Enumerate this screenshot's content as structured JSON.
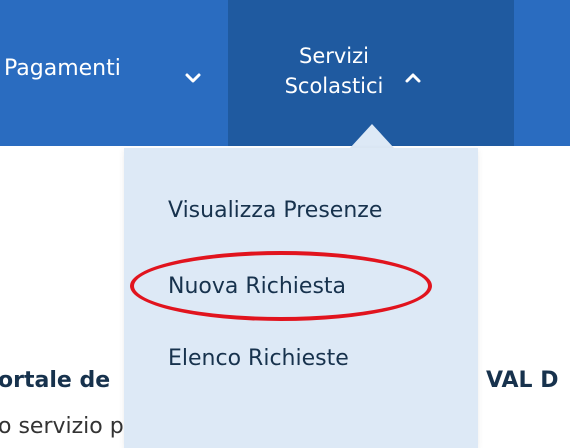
{
  "navbar": {
    "items": [
      {
        "label": "Pagamenti",
        "expanded": false,
        "icon": "chevron-down-icon"
      },
      {
        "label_line1": "Servizi",
        "label_line2": "Scolastici",
        "expanded": true,
        "icon": "chevron-up-icon"
      }
    ]
  },
  "dropdown": {
    "items": [
      {
        "label": "Visualizza Presenze"
      },
      {
        "label": "Nuova Richiesta",
        "highlighted": true
      },
      {
        "label": "Elenco Richieste"
      }
    ]
  },
  "page": {
    "heading_left": "ortale de",
    "heading_right": "VAL D",
    "text": "o servizio potrai accedere comodamente"
  },
  "colors": {
    "navbar": "#2a6cc0",
    "navbar_active": "#1f5aa0",
    "dropdown_bg": "#dde9f6",
    "dropdown_text": "#17324d",
    "highlight": "#e1141e"
  }
}
